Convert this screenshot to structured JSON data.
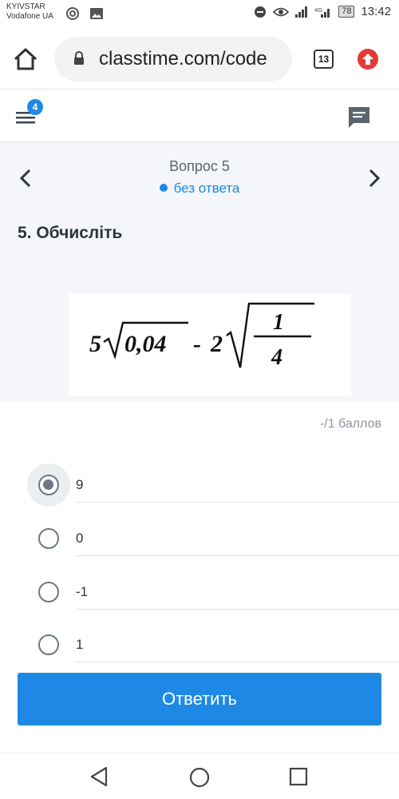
{
  "status_bar": {
    "carrier1": "KYIVSTAR",
    "carrier2": "Vodafone UA",
    "battery": "78",
    "time": "13:42",
    "icons": [
      "hotspot-icon",
      "image-icon",
      "dnd-icon",
      "eye-icon",
      "signal-icon",
      "4g-icon",
      "signal-icon"
    ]
  },
  "browser": {
    "url": "classtime.com/code",
    "tabs_count": "13"
  },
  "app_header": {
    "menu_badge": "4"
  },
  "question": {
    "title": "Вопрос 5",
    "status": "без ответа",
    "heading": "5. Обчисліть",
    "formula": {
      "coef1": "5",
      "radicand1": "0,04",
      "minus": "-",
      "coef2": "2",
      "numerator": "1",
      "denominator": "4"
    },
    "points": "-/1 баллов"
  },
  "options": [
    {
      "label": "9",
      "checked": true
    },
    {
      "label": "0",
      "checked": false
    },
    {
      "label": "-1",
      "checked": false
    },
    {
      "label": "1",
      "checked": false
    }
  ],
  "submit_label": "Ответить",
  "colors": {
    "accent": "#1e88e5",
    "upload_red": "#e53935",
    "panel_bg": "#f4f6f9"
  }
}
